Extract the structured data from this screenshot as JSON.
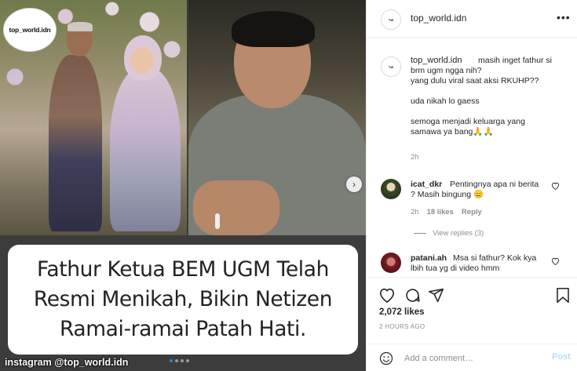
{
  "media": {
    "logo_text": "top_world.idn",
    "caption_lines": [
      "Fathur Ketua BEM UGM Telah",
      "Resmi Menikah, Bikin Netizen",
      "Ramai-ramai Patah Hati."
    ],
    "watermark": "instagram @top_world.idn",
    "carousel_dots": 4,
    "carousel_active_index": 0
  },
  "header": {
    "username": "top_world.idn",
    "more_icon": "more-horizontal-icon"
  },
  "caption": {
    "username": "top_world.idn",
    "lines": [
      "masih inget fathur si",
      "brm ugm ngga nih?",
      "yang dulu viral saat aksi RKUHP??",
      "",
      "uda nikah lo gaess",
      "",
      "semoga menjadi keluarga yang",
      "samawa ya bang🙏🙏"
    ],
    "time": "2h"
  },
  "comments": [
    {
      "username": "icat_dkr",
      "lines": [
        "Pentingnya apa ni berita",
        "? Masih bingung 😑"
      ],
      "time": "2h",
      "likes": "18 likes",
      "reply_label": "Reply",
      "view_replies": "View replies (3)"
    },
    {
      "username": "patani.ah",
      "lines": [
        "Msa si fathur? Kok kya",
        "lbih tua yg di video hmm"
      ]
    }
  ],
  "actions": {
    "likes_count": "2,072 likes",
    "post_time": "2 HOURS AGO",
    "comment_placeholder": "Add a comment…",
    "post_label": "Post"
  },
  "colors": {
    "accent_blue": "#0095f6",
    "post_disabled": "#b2dffc",
    "muted_text": "#8e8e8e"
  }
}
